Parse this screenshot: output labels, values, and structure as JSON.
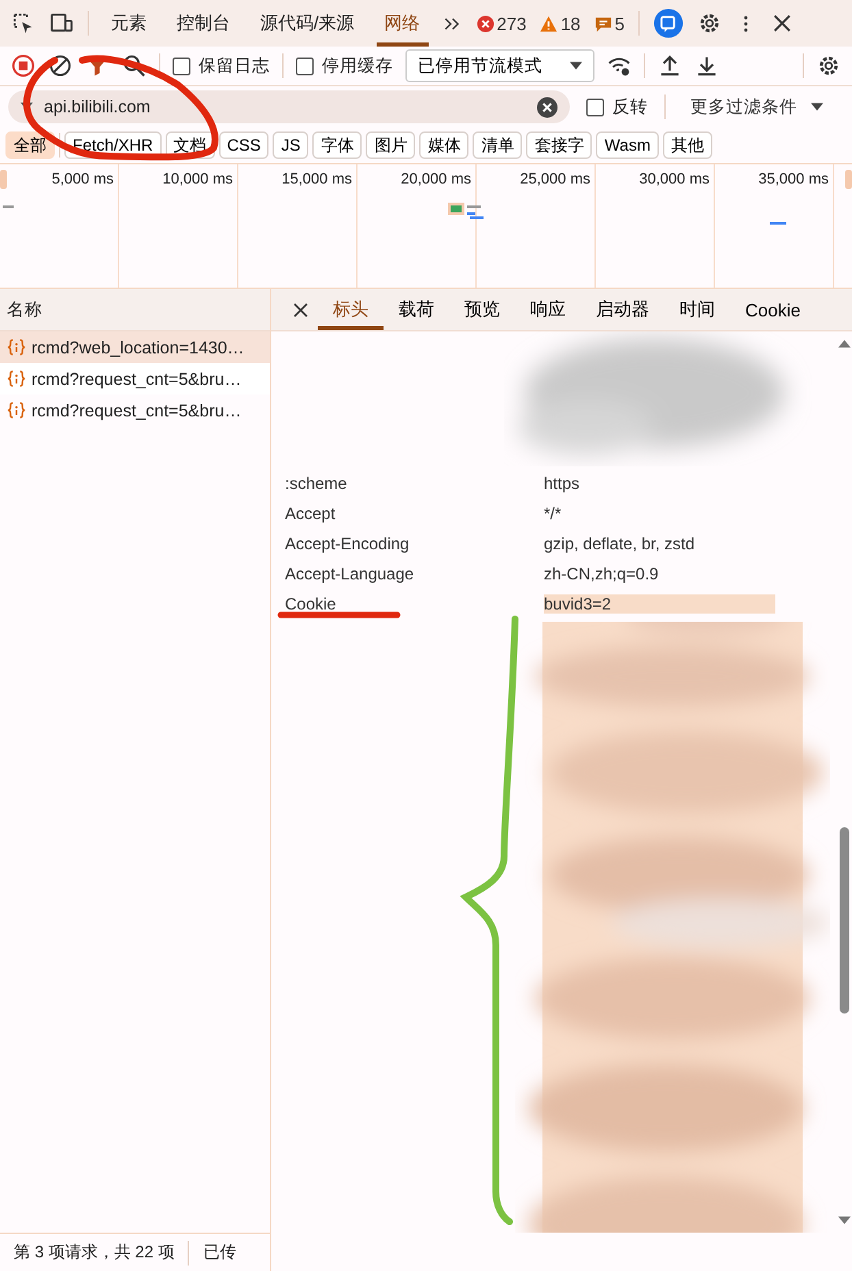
{
  "devtools_tabs": [
    {
      "label": "元素",
      "selected": false
    },
    {
      "label": "控制台",
      "selected": false
    },
    {
      "label": "源代码/来源",
      "selected": false
    },
    {
      "label": "网络",
      "selected": true
    }
  ],
  "issues": {
    "errors": "273",
    "warnings": "18",
    "messages": "5"
  },
  "toolbar": {
    "preserve_log": {
      "label": "保留日志",
      "checked": false
    },
    "disable_cache": {
      "label": "停用缓存",
      "checked": false
    },
    "throttling": "已停用节流模式"
  },
  "filter": {
    "value": "api.bilibili.com",
    "invert": {
      "label": "反转",
      "checked": false
    },
    "more_filters": "更多过滤条件"
  },
  "type_filters": [
    {
      "label": "全部",
      "selected": true
    },
    {
      "label": "Fetch/XHR",
      "selected": false
    },
    {
      "label": "文档",
      "selected": false
    },
    {
      "label": "CSS",
      "selected": false
    },
    {
      "label": "JS",
      "selected": false
    },
    {
      "label": "字体",
      "selected": false
    },
    {
      "label": "图片",
      "selected": false
    },
    {
      "label": "媒体",
      "selected": false
    },
    {
      "label": "清单",
      "selected": false
    },
    {
      "label": "套接字",
      "selected": false
    },
    {
      "label": "Wasm",
      "selected": false
    },
    {
      "label": "其他",
      "selected": false
    }
  ],
  "timeline": {
    "ticks": [
      "5,000 ms",
      "10,000 ms",
      "15,000 ms",
      "20,000 ms",
      "25,000 ms",
      "30,000 ms",
      "35,000 ms"
    ]
  },
  "requests": {
    "header": "名称",
    "rows": [
      {
        "name": "rcmd?web_location=1430…",
        "selected": true
      },
      {
        "name": "rcmd?request_cnt=5&bru…",
        "selected": false
      },
      {
        "name": "rcmd?request_cnt=5&bru…",
        "selected": false
      }
    ]
  },
  "detail": {
    "tabs": [
      {
        "label": "标头",
        "selected": true
      },
      {
        "label": "载荷",
        "selected": false
      },
      {
        "label": "预览",
        "selected": false
      },
      {
        "label": "响应",
        "selected": false
      },
      {
        "label": "启动器",
        "selected": false
      },
      {
        "label": "时间",
        "selected": false
      },
      {
        "label": "Cookie",
        "selected": false
      }
    ],
    "headers": [
      {
        "name": ":scheme",
        "value": "https",
        "highlighted": false
      },
      {
        "name": "Accept",
        "value": "*/*",
        "highlighted": false
      },
      {
        "name": "Accept-Encoding",
        "value": "gzip, deflate, br, zstd",
        "highlighted": false
      },
      {
        "name": "Accept-Language",
        "value": "zh-CN,zh;q=0.9",
        "highlighted": false
      },
      {
        "name": "Cookie",
        "value": "buvid3=2",
        "highlighted": true
      }
    ]
  },
  "status_bar": {
    "summary": "第 3 项请求，共 22 项",
    "transferred": "已传"
  }
}
